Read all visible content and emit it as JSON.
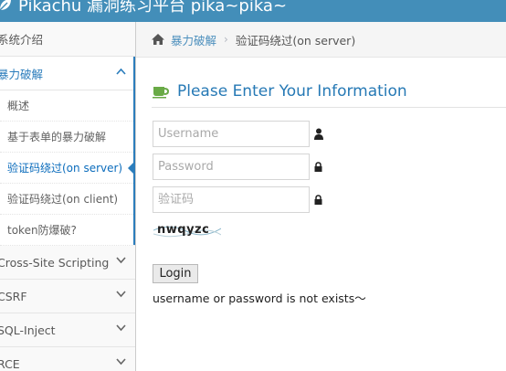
{
  "navbar": {
    "brand": "Pikachu 漏洞练习平台 pika~pika~",
    "brand_icon": "leaf-icon"
  },
  "sidebar": {
    "items": [
      {
        "label": "系统介绍"
      },
      {
        "label": "暴力破解",
        "open": true
      },
      {
        "label": "Cross-Site Scripting"
      },
      {
        "label": "CSRF"
      },
      {
        "label": "SQL-Inject"
      },
      {
        "label": "RCE"
      }
    ],
    "submenu": [
      {
        "label": "概述"
      },
      {
        "label": "基于表单的暴力破解"
      },
      {
        "label": "验证码绕过(on server)",
        "active": true
      },
      {
        "label": "验证码绕过(on client)"
      },
      {
        "label": "token防爆破?"
      }
    ]
  },
  "breadcrumb": {
    "link": "暴力破解",
    "current": "验证码绕过(on server)"
  },
  "content": {
    "title": "Please Enter Your Information",
    "username_placeholder": "Username",
    "password_placeholder": "Password",
    "captcha_placeholder": "验证码",
    "captcha_text": "nwqyzc",
    "login_label": "Login",
    "message": "username or password is not exists～"
  },
  "colors": {
    "navbar": "#438eb9",
    "accent": "#2b7dbc",
    "title": "#2679b5"
  }
}
